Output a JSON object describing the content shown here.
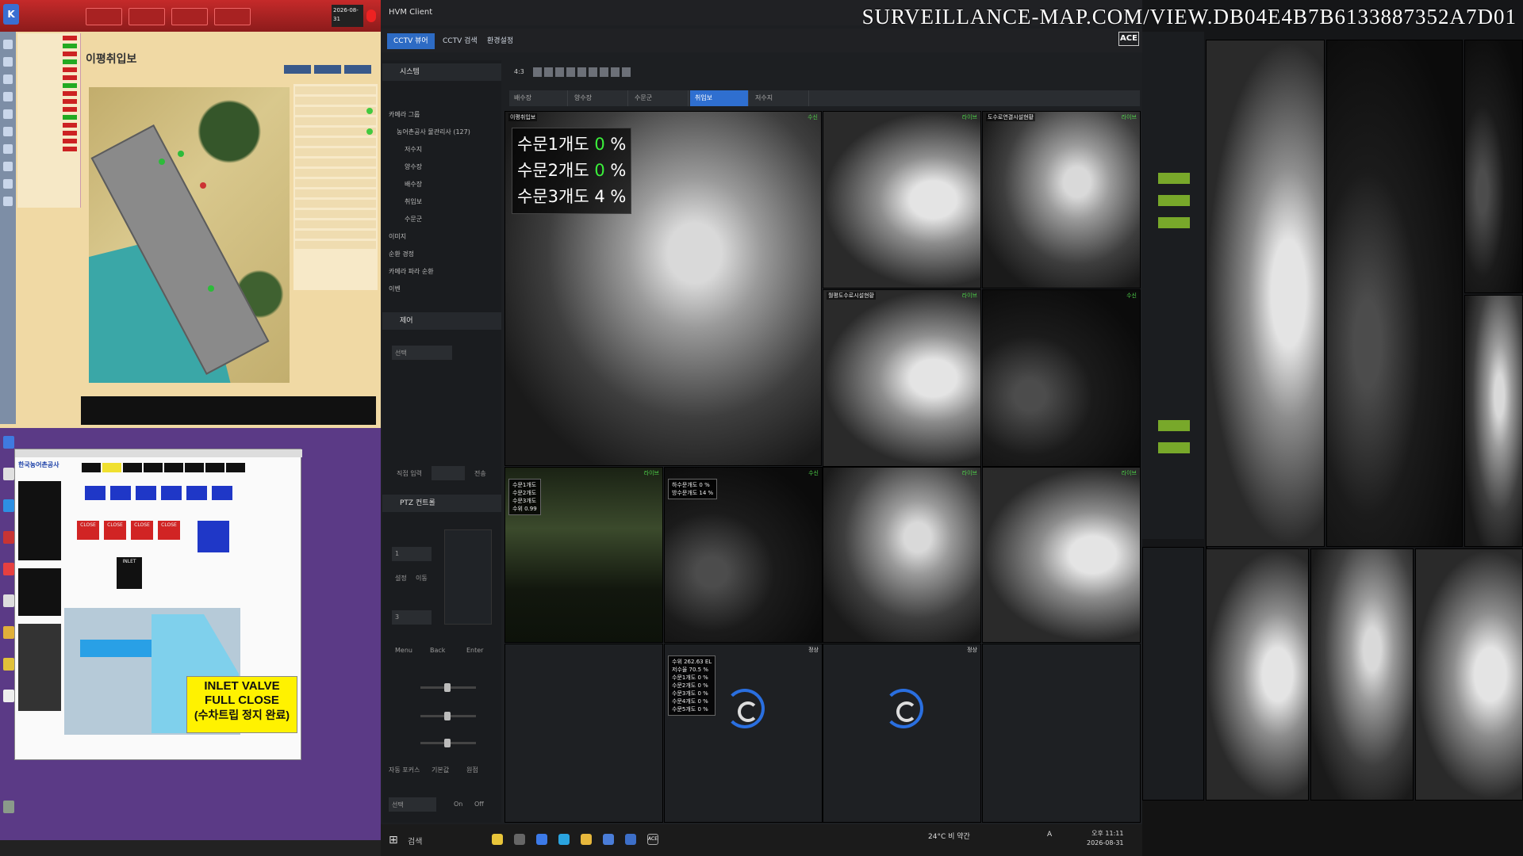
{
  "watermark": "SURVEILLANCE-MAP.COM/VIEW.DB04E4B7B6133887352A7D01",
  "scada1": {
    "title": "이평취입보",
    "clock": "2026-08-31",
    "tabs": [
      "",
      "",
      ""
    ]
  },
  "scada2": {
    "brand": "한국농어촌공사",
    "banner": [
      "INLET VALVE",
      "FULL CLOSE",
      "(수차트립 정지 완료)"
    ],
    "status_cells": [
      "CLOSE",
      "CLOSE",
      "CLOSE",
      "CLOSE"
    ],
    "valve_cells": [
      "INLET"
    ]
  },
  "hvm": {
    "window_title": "HVM Client",
    "menu_tabs": [
      "CCTV 뷰어",
      "CCTV 검색",
      "환경설정"
    ],
    "ace_label": "ACE",
    "ratio_label": "4:3",
    "sidebar": {
      "system_header": "시스템",
      "tree": [
        "카메라 그룹",
        "농어촌공사 물관리사 (127)",
        "저수지",
        "양수장",
        "배수장",
        "취입보",
        "수문군",
        "이미지",
        "순환 경정",
        "카메라 파라 순환",
        "이벤"
      ],
      "control_header": "제어",
      "control_select": "선택",
      "direct_input_label": "직접 입력",
      "direct_input_button": "전송",
      "ptz_header": "PTZ 컨트롤",
      "ptz_speed": "1",
      "ptz_home": "3",
      "ptz_buttons": [
        "설정",
        "이동"
      ],
      "menu_buttons": [
        "Menu",
        "Back",
        "Enter"
      ],
      "focus_buttons": [
        "자동 포커스",
        "기본값",
        "원점"
      ],
      "bottom_select": "선택",
      "on_off": [
        "On",
        "Off"
      ]
    },
    "content_tabs": [
      "배수장",
      "양수장",
      "수문군",
      "취입보",
      "저수지"
    ],
    "active_tab_index": 3,
    "main_overlay": [
      "수문1개도",
      "0",
      "%",
      "수문2개도",
      "0",
      "%",
      "수문3개도",
      "4",
      "%"
    ],
    "cams": [
      {
        "label": "이평취입보",
        "status": "수신"
      },
      {
        "label": "",
        "status": "라이브"
      },
      {
        "label": "도수로연결시설현황",
        "status": "라이브"
      },
      {
        "label": "월평도수로시설현황",
        "status": "라이브"
      },
      {
        "label": "",
        "status": "수신"
      },
      {
        "label": "",
        "status": "라이브"
      },
      {
        "label": "",
        "status": "수신"
      },
      {
        "label": "",
        "status": "라이브"
      },
      {
        "label": "",
        "status": "라이브"
      },
      {
        "label": "",
        "status": "정상"
      },
      {
        "label": "",
        "status": "정상"
      }
    ],
    "cam_box_a": [
      "수문1개도",
      "수문2개도",
      "수문3개도",
      "수위 0.99"
    ],
    "cam_box_b": [
      "하수문개도 0 %",
      "방수문개도 14 %"
    ],
    "cam_box_c": [
      "수위 262.63 EL",
      "저수율 70.5 %",
      "수문1개도 0 %",
      "수문2개도 0 %",
      "수문3개도 0 %",
      "수문4개도 0 %",
      "수문5개도 0 %"
    ]
  },
  "taskbar": {
    "search": "검색",
    "weather": "24°C 비 약간",
    "clock_time": "오후 11:11",
    "clock_date": "2026-08-31",
    "ime": "A"
  }
}
